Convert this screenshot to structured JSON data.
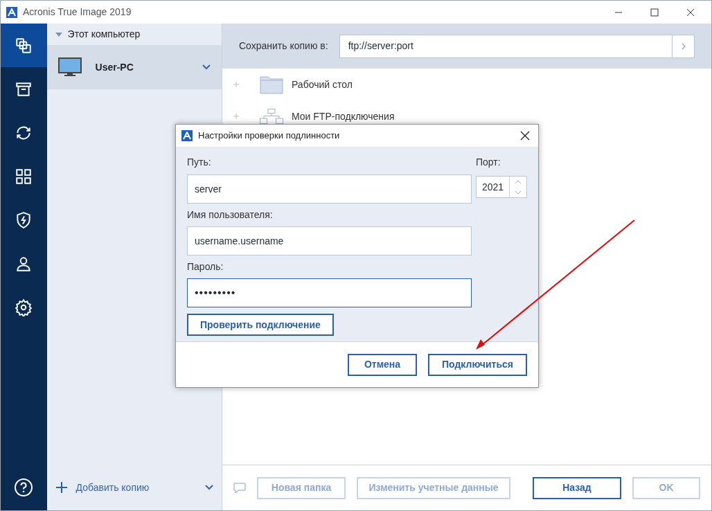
{
  "window": {
    "title": "Acronis True Image 2019"
  },
  "nav": [
    {
      "selected": true
    },
    {
      "selected": false
    },
    {
      "selected": false
    },
    {
      "selected": false
    },
    {
      "selected": false
    },
    {
      "selected": false
    },
    {
      "selected": false
    }
  ],
  "sources": {
    "header": "Этот компьютер",
    "items": [
      {
        "label": "User-PC",
        "selected": true
      }
    ],
    "add_label": "Добавить копию"
  },
  "destination": {
    "label": "Сохранить копию в:",
    "value": "ftp://server:port"
  },
  "tree": [
    {
      "label": "Рабочий стол",
      "kind": "folder"
    },
    {
      "label": "Мои FTP-подключения",
      "kind": "network"
    }
  ],
  "bottom_buttons": [
    {
      "label": "Новая папка",
      "disabled": true
    },
    {
      "label": "Изменить учетные данные",
      "disabled": true
    },
    {
      "label": "Назад",
      "disabled": false
    },
    {
      "label": "OK",
      "disabled": true
    }
  ],
  "dialog": {
    "title": "Настройки проверки подлинности",
    "path_label": "Путь:",
    "path": "server",
    "port_label": "Порт:",
    "port": "2021",
    "user_label": "Имя пользователя:",
    "user": "username.username",
    "password_label": "Пароль:",
    "password": "•••••••••",
    "test_button": "Проверить подключение",
    "buttons": [
      "Отмена",
      "Подключиться"
    ]
  }
}
